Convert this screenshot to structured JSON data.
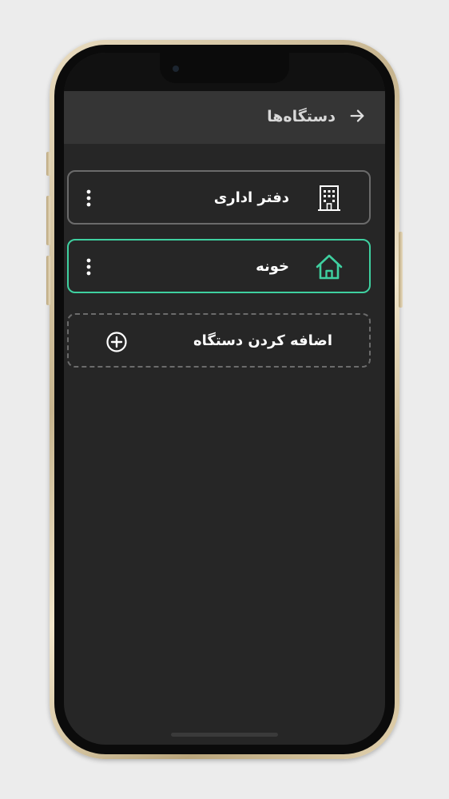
{
  "header": {
    "title": "دستگاه‌ها",
    "back_icon": "arrow-right-icon"
  },
  "devices": [
    {
      "label": "دفتر اداری",
      "icon": "office-building-icon",
      "selected": false,
      "menu_icon": "more-vertical-icon"
    },
    {
      "label": "خونه",
      "icon": "home-icon",
      "selected": true,
      "menu_icon": "more-vertical-icon"
    }
  ],
  "add_device": {
    "label": "اضافه کردن دستگاه",
    "icon": "plus-circle-icon"
  },
  "colors": {
    "screen_bg": "#262626",
    "header_bg": "#353535",
    "accent": "#3fd0a0",
    "card_border": "#6b6b6b",
    "text": "#ffffff"
  }
}
